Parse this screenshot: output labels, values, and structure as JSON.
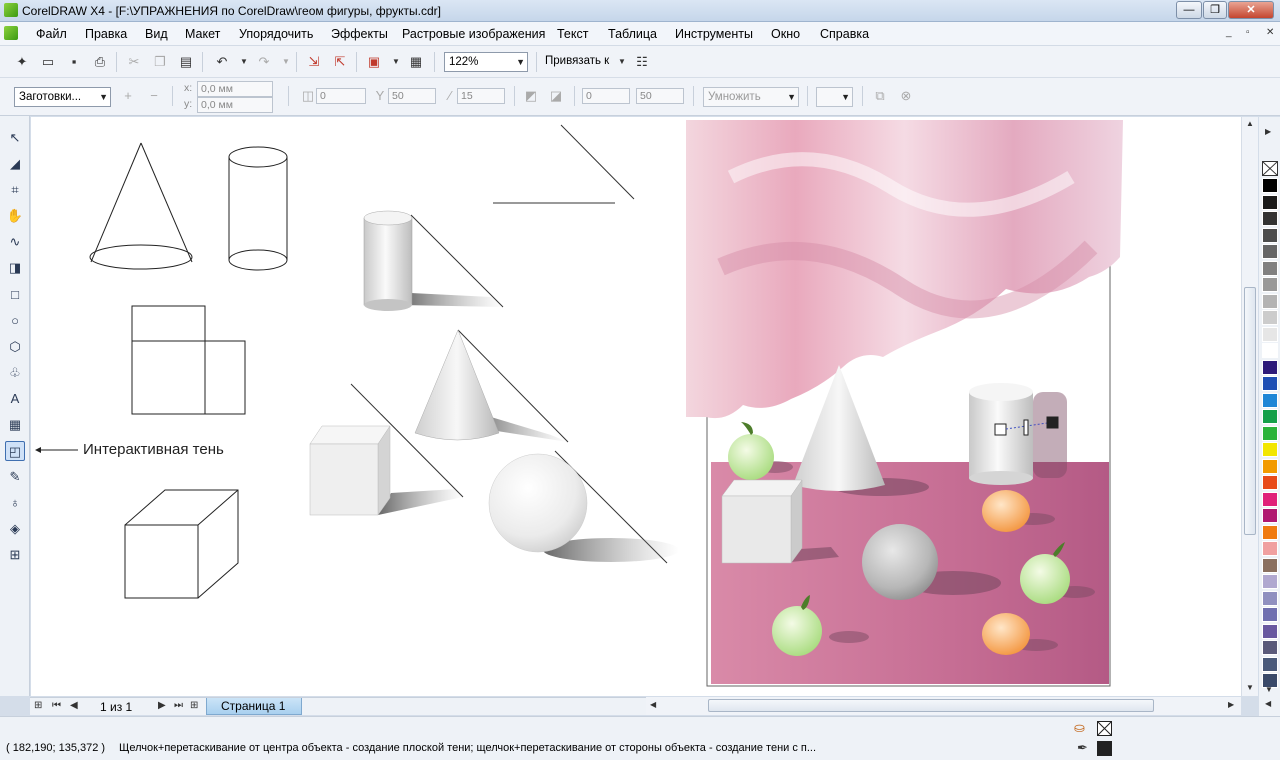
{
  "window": {
    "title": "CorelDRAW X4 - [F:\\УПРАЖНЕНИЯ по CorelDraw\\геом фигуры, фрукты.cdr]",
    "minimize": "—",
    "maximize": "❐",
    "close": "✕"
  },
  "menubar": {
    "items": [
      "Файл",
      "Правка",
      "Вид",
      "Макет",
      "Упорядочить",
      "Эффекты",
      "Растровые изображения",
      "Текст",
      "Таблица",
      "Инструменты",
      "Окно",
      "Справка"
    ],
    "mdi_min": "_",
    "mdi_restore": "▫",
    "mdi_close": "✕"
  },
  "toolbar1": {
    "zoom": "122%",
    "snap_label": "Привязать к"
  },
  "toolbar2": {
    "presets": "Заготовки...",
    "x_label": "x:",
    "y_label": "y:",
    "x_value": "0,0 мм",
    "y_value": "0,0 мм",
    "angle_value": "0",
    "opacity_value": "50",
    "feather_value": "15",
    "fade_value": "0",
    "stretch_value": "50",
    "blend_mode": "Умножить",
    "color_swatch": "#ffffff"
  },
  "canvas": {
    "annotation": "Интерактивная тень"
  },
  "pagenav": {
    "page_count": "1 из 1",
    "page_tab": "Страница 1"
  },
  "palette": {
    "colors": [
      "#000000",
      "#1a1a1a",
      "#333333",
      "#4d4d4d",
      "#666666",
      "#808080",
      "#999999",
      "#b3b3b3",
      "#cccccc",
      "#e6e6e6",
      "#ffffff",
      "#2e1a7a",
      "#1f4fb4",
      "#1e86d6",
      "#14a04a",
      "#2ab33a",
      "#f2e600",
      "#f29a00",
      "#e84a1a",
      "#e0207a",
      "#b01870",
      "#f07a10",
      "#f0a0a0",
      "#8a7060",
      "#b0a8d0",
      "#9090c0",
      "#7070b0",
      "#6858a0",
      "#5a5a7a",
      "#4a5a7a",
      "#3a4a6a"
    ]
  },
  "status": {
    "coords": "( 182,190; 135,372 )",
    "hint": "Щелчок+перетаскивание от центра объекта - создание плоской тени; щелчок+перетаскивание от стороны объекта - создание тени с п..."
  }
}
